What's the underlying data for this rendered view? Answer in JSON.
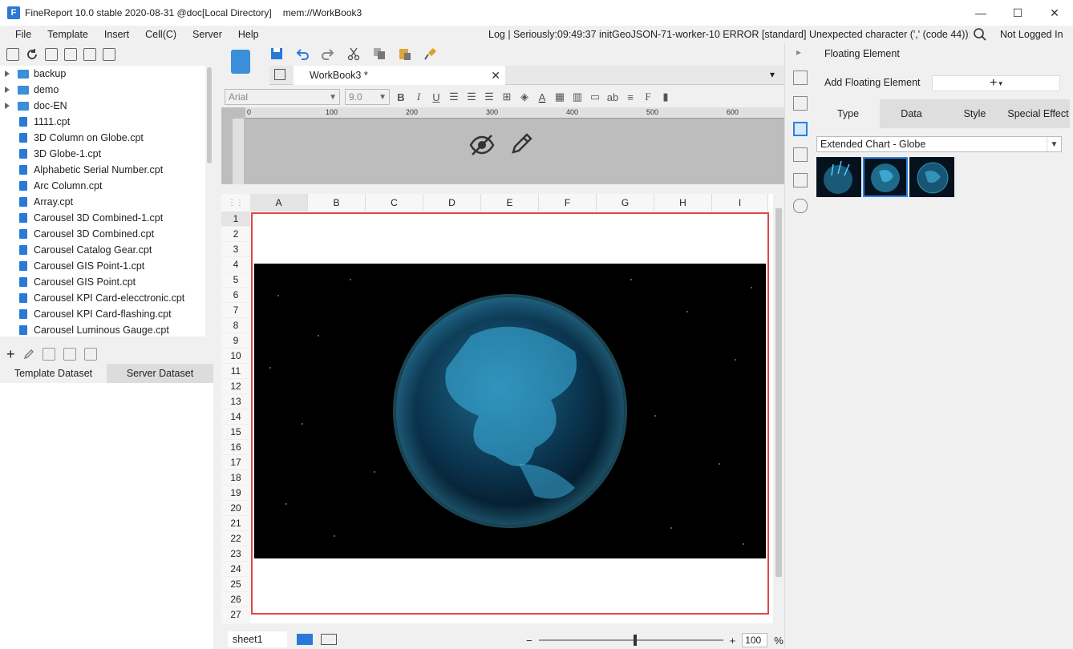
{
  "window": {
    "title": "FineReport 10.0 stable 2020-08-31 @doc[Local Directory]",
    "subtitle": "mem://WorkBook3",
    "minimize": "—",
    "maximize": "☐",
    "close": "✕"
  },
  "menubar": {
    "items": [
      "File",
      "Template",
      "Insert",
      "Cell(C)",
      "Server",
      "Help"
    ],
    "log": "Log | Seriously:09:49:37 initGeoJSON-71-worker-10 ERROR [standard] Unexpected character (',' (code 44)): ...",
    "login": "Not Logged In"
  },
  "tree": {
    "folders": [
      "backup",
      "demo",
      "doc-EN"
    ],
    "files": [
      "1111.cpt",
      "3D Column on Globe.cpt",
      "3D Globe-1.cpt",
      "Alphabetic Serial Number.cpt",
      "Arc Column.cpt",
      "Array.cpt",
      "Carousel 3D Combined-1.cpt",
      "Carousel 3D Combined.cpt",
      "Carousel Catalog Gear.cpt",
      "Carousel GIS Point-1.cpt",
      "Carousel GIS Point.cpt",
      "Carousel KPI Card-elecctronic.cpt",
      "Carousel KPI Card-flashing.cpt",
      "Carousel Luminous Gauge.cpt"
    ]
  },
  "dataset_tabs": {
    "template": "Template Dataset",
    "server": "Server Dataset"
  },
  "editor": {
    "doc_tab": "WorkBook3 *",
    "font": "Arial",
    "font_size": "9.0",
    "ruler_labels": [
      "0",
      "100",
      "200",
      "300",
      "400",
      "500",
      "600"
    ],
    "columns": [
      "A",
      "B",
      "C",
      "D",
      "E",
      "F",
      "G",
      "H",
      "I"
    ],
    "rows": [
      "1",
      "2",
      "3",
      "4",
      "5",
      "6",
      "7",
      "8",
      "9",
      "10",
      "11",
      "12",
      "13",
      "14",
      "15",
      "16",
      "17",
      "18",
      "19",
      "20",
      "21",
      "22",
      "23",
      "24",
      "25",
      "26",
      "27"
    ],
    "sheet_tab": "sheet1",
    "zoom_minus": "−",
    "zoom_plus": "+",
    "zoom_value": "100",
    "zoom_unit": "%"
  },
  "right_panel": {
    "title": "Floating Element",
    "add_label": "Add Floating Element",
    "add_icon": "+",
    "tabs": [
      "Type",
      "Data",
      "Style",
      "Special Effect"
    ],
    "chart_type": "Extended Chart - Globe"
  },
  "colors": {
    "selection_border": "#e04646",
    "accent": "#2d7fe0",
    "globe_glow": "#4fd0ff"
  }
}
